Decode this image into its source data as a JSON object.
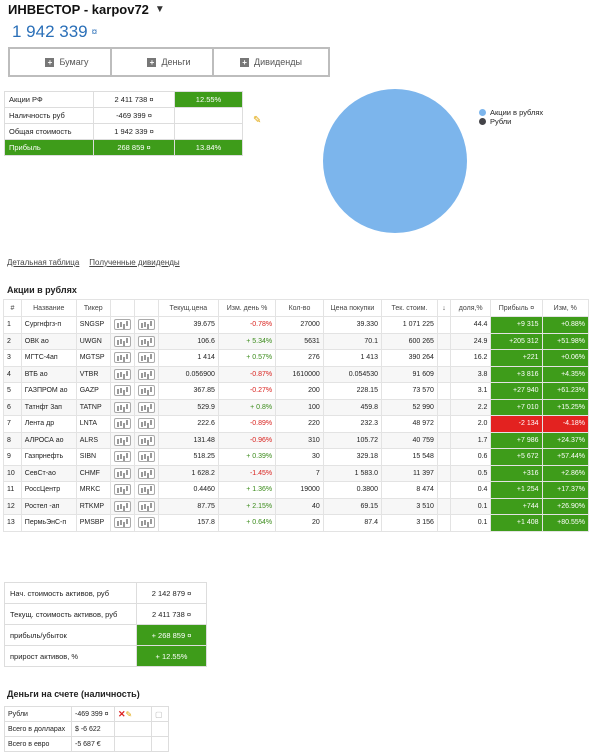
{
  "header": {
    "title": "ИНВЕСТОР - karpov72",
    "total": "1 942 339",
    "currency": "¤"
  },
  "buttons": {
    "bond": "Бумагу",
    "money": "Деньги",
    "dividends": "Дивиденды"
  },
  "summary": [
    {
      "label": "Акции РФ",
      "value": "2 411 738 ¤",
      "extra": "12.55%",
      "extra_style": "g"
    },
    {
      "label": "Наличность руб",
      "value": "-469 399 ¤",
      "extra": "",
      "extra_style": ""
    },
    {
      "label": "Общая стоимость",
      "value": "1 942 339 ¤",
      "extra": "",
      "extra_style": ""
    },
    {
      "label": "Прибыль",
      "value": "268 859 ¤",
      "extra": "13.84%",
      "extra_style": "g"
    }
  ],
  "pie": {
    "legend": [
      {
        "name": "Акции в рублях",
        "color": "#7cb5ec"
      },
      {
        "name": "Рубли",
        "color": "#434348"
      }
    ],
    "slices": [
      {
        "name": "Акции в рублях",
        "value": 2411738
      },
      {
        "name": "Рубли",
        "value": 0
      }
    ]
  },
  "links": {
    "detailed": "Детальная таблица",
    "dividends": "Полученные дивиденды"
  },
  "stocks_section": "Акции в рублях",
  "columns": [
    "#",
    "Название",
    "Тикер",
    "",
    "",
    "Текущ.цена",
    "Изм. день %",
    "Кол-во",
    "Цена покупки",
    "Тек. стоим.",
    "↓",
    "доля,%",
    "Прибыль ¤",
    "Изм, %"
  ],
  "stocks": [
    {
      "n": "1",
      "name": "Сургнфгз-п",
      "ticker": "SNGSP",
      "price": "39.675",
      "day": "-0.78%",
      "qty": "27000",
      "buy": "39.330",
      "value": "1 071 225",
      "share": "44.4",
      "profit": "+9 315",
      "chg": "+0.88%",
      "st": "g"
    },
    {
      "n": "2",
      "name": "ОВК ао",
      "ticker": "UWGN",
      "price": "106.6",
      "day": "+ 5.34%",
      "qty": "5631",
      "buy": "70.1",
      "value": "600 265",
      "share": "24.9",
      "profit": "+205 312",
      "chg": "+51.98%",
      "st": "g"
    },
    {
      "n": "3",
      "name": "МГТС-4ап",
      "ticker": "MGTSP",
      "price": "1 414",
      "day": "+ 0.57%",
      "qty": "276",
      "buy": "1 413",
      "value": "390 264",
      "share": "16.2",
      "profit": "+221",
      "chg": "+0.06%",
      "st": "g"
    },
    {
      "n": "4",
      "name": "ВТБ ао",
      "ticker": "VTBR",
      "price": "0.056900",
      "day": "-0.87%",
      "qty": "1610000",
      "buy": "0.054530",
      "value": "91 609",
      "share": "3.8",
      "profit": "+3 816",
      "chg": "+4.35%",
      "st": "g"
    },
    {
      "n": "5",
      "name": "ГАЗПРОМ ао",
      "ticker": "GAZP",
      "price": "367.85",
      "day": "-0.27%",
      "qty": "200",
      "buy": "228.15",
      "value": "73 570",
      "share": "3.1",
      "profit": "+27 940",
      "chg": "+61.23%",
      "st": "g"
    },
    {
      "n": "6",
      "name": "Татнфт 3ап",
      "ticker": "TATNP",
      "price": "529.9",
      "day": "+ 0.8%",
      "qty": "100",
      "buy": "459.8",
      "value": "52 990",
      "share": "2.2",
      "profit": "+7 010",
      "chg": "+15.25%",
      "st": "g"
    },
    {
      "n": "7",
      "name": "Лента др",
      "ticker": "LNTA",
      "price": "222.6",
      "day": "-0.89%",
      "qty": "220",
      "buy": "232.3",
      "value": "48 972",
      "share": "2.0",
      "profit": "-2 134",
      "chg": "-4.18%",
      "st": "r"
    },
    {
      "n": "8",
      "name": "АЛРОСА ао",
      "ticker": "ALRS",
      "price": "131.48",
      "day": "-0.96%",
      "qty": "310",
      "buy": "105.72",
      "value": "40 759",
      "share": "1.7",
      "profit": "+7 986",
      "chg": "+24.37%",
      "st": "g"
    },
    {
      "n": "9",
      "name": "Газпрнефть",
      "ticker": "SIBN",
      "price": "518.25",
      "day": "+ 0.39%",
      "qty": "30",
      "buy": "329.18",
      "value": "15 548",
      "share": "0.6",
      "profit": "+5 672",
      "chg": "+57.44%",
      "st": "g"
    },
    {
      "n": "10",
      "name": "СевСт-ао",
      "ticker": "CHMF",
      "price": "1 628.2",
      "day": "-1.45%",
      "qty": "7",
      "buy": "1 583.0",
      "value": "11 397",
      "share": "0.5",
      "profit": "+316",
      "chg": "+2.86%",
      "st": "g"
    },
    {
      "n": "11",
      "name": "РоссЦентр",
      "ticker": "MRKC",
      "price": "0.4460",
      "day": "+ 1.36%",
      "qty": "19000",
      "buy": "0.3800",
      "value": "8 474",
      "share": "0.4",
      "profit": "+1 254",
      "chg": "+17.37%",
      "st": "g"
    },
    {
      "n": "12",
      "name": "Ростел -ап",
      "ticker": "RTKMP",
      "price": "87.75",
      "day": "+ 2.15%",
      "qty": "40",
      "buy": "69.15",
      "value": "3 510",
      "share": "0.1",
      "profit": "+744",
      "chg": "+26.90%",
      "st": "g"
    },
    {
      "n": "13",
      "name": "ПермьЭнС-п",
      "ticker": "PMSBP",
      "price": "157.8",
      "day": "+ 0.64%",
      "qty": "20",
      "buy": "87.4",
      "value": "3 156",
      "share": "0.1",
      "profit": "+1 408",
      "chg": "+80.55%",
      "st": "g"
    }
  ],
  "assets": [
    {
      "label": "Нач. стоимость активов, руб",
      "value": "2 142 879 ¤",
      "style": ""
    },
    {
      "label": "Текущ. стоимость активов, руб",
      "value": "2 411 738 ¤",
      "style": ""
    },
    {
      "label": "прибыль/убыток",
      "value": "+ 268 859 ¤",
      "style": "g"
    },
    {
      "label": "прирост активов, %",
      "value": "+ 12.55%",
      "style": "g"
    }
  ],
  "cash_section": "Деньги на счете (наличность)",
  "cash": [
    {
      "label": "Рубли",
      "value": "-469 399 ¤"
    },
    {
      "label": "Всего в долларах",
      "value": "$ -6 622"
    },
    {
      "label": "Всего в евро",
      "value": "-5 687 €"
    }
  ]
}
